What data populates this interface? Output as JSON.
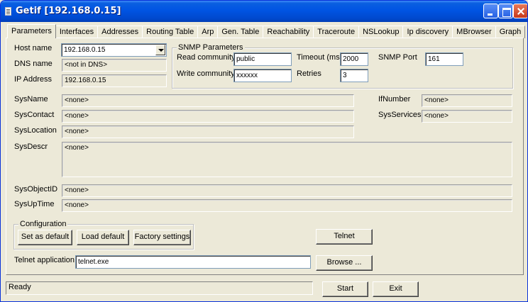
{
  "window": {
    "title": "Getif [192.168.0.15]"
  },
  "tabs": [
    "Parameters",
    "Interfaces",
    "Addresses",
    "Routing Table",
    "Arp",
    "Gen. Table",
    "Reachability",
    "Traceroute",
    "NSLookup",
    "Ip discovery",
    "MBrowser",
    "Graph"
  ],
  "host": {
    "host_name_label": "Host name",
    "host_name_value": "192.168.0.15",
    "dns_name_label": "DNS name",
    "dns_name_value": "<not in DNS>",
    "ip_address_label": "IP Address",
    "ip_address_value": "192.168.0.15"
  },
  "snmp": {
    "group_title": "SNMP Parameters",
    "read_community_label": "Read community",
    "read_community_value": "public",
    "write_community_label": "Write community",
    "write_community_value": "xxxxxx",
    "timeout_label": "Timeout (ms)",
    "timeout_value": "2000",
    "retries_label": "Retries",
    "retries_value": "3",
    "port_label": "SNMP Port",
    "port_value": "161"
  },
  "system": {
    "sysname_label": "SysName",
    "sysname_value": "<none>",
    "syscontact_label": "SysContact",
    "syscontact_value": "<none>",
    "syslocation_label": "SysLocation",
    "syslocation_value": "<none>",
    "sysdescr_label": "SysDescr",
    "sysdescr_value": "<none>",
    "sysobjectid_label": "SysObjectID",
    "sysobjectid_value": "<none>",
    "sysuptime_label": "SysUpTime",
    "sysuptime_value": "<none>",
    "ifnumber_label": "IfNumber",
    "ifnumber_value": "<none>",
    "sysservices_label": "SysServices",
    "sysservices_value": "<none>"
  },
  "configuration": {
    "group_title": "Configuration",
    "set_default": "Set as default",
    "load_default": "Load default",
    "factory_settings": "Factory settings"
  },
  "telnet": {
    "button": "Telnet",
    "app_label": "Telnet application",
    "app_value": "telnet.exe",
    "browse": "Browse ..."
  },
  "status": {
    "text": "Ready"
  },
  "actions": {
    "start": "Start",
    "exit": "Exit"
  }
}
